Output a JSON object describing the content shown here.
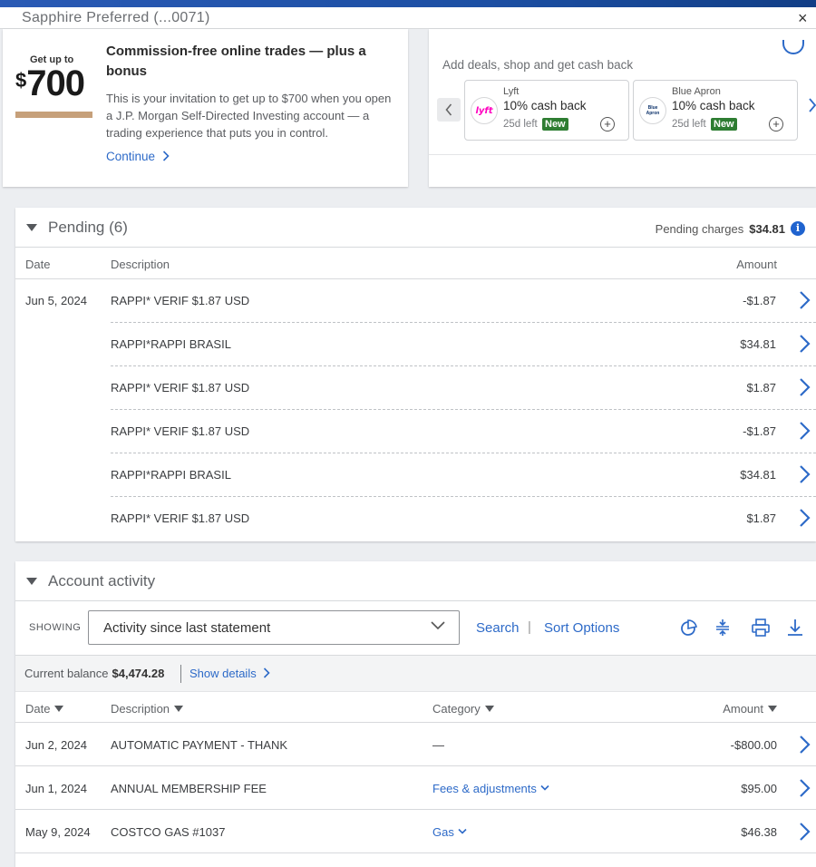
{
  "titlebar": {
    "account": "Sapphire Preferred (...0071)",
    "close": "×"
  },
  "promo": {
    "get_up_to": "Get up to",
    "dollar": "$",
    "amount": "700",
    "headline": "Commission-free online trades — plus a bonus",
    "body": "This is your invitation to get up to $700 when you open a J.P. Morgan Self-Directed Investing account — a trading experience that puts you in control.",
    "continue": "Continue"
  },
  "deals": {
    "title": "Add deals, shop and get cash back",
    "items": [
      {
        "brand": "Lyft",
        "offer": "10% cash back",
        "left": "25d left",
        "badge": "New",
        "logo_text": "lyft",
        "logo_color": "#ff00bf"
      },
      {
        "brand": "Blue Apron",
        "offer": "10% cash back",
        "left": "25d left",
        "badge": "New",
        "logo_text": "Blue Apron",
        "logo_color": "#0f346c"
      }
    ]
  },
  "pending": {
    "title": "Pending (6)",
    "charges_label": "Pending charges",
    "charges_value": "$34.81",
    "columns": {
      "date": "Date",
      "description": "Description",
      "amount": "Amount"
    },
    "rows": [
      {
        "date": "Jun 5, 2024",
        "description": "RAPPI* VERIF $1.87 USD",
        "amount": "-$1.87"
      },
      {
        "date": "",
        "description": "RAPPI*RAPPI BRASIL",
        "amount": "$34.81"
      },
      {
        "date": "",
        "description": "RAPPI* VERIF $1.87 USD",
        "amount": "$1.87"
      },
      {
        "date": "",
        "description": "RAPPI* VERIF $1.87 USD",
        "amount": "-$1.87"
      },
      {
        "date": "",
        "description": "RAPPI*RAPPI BRASIL",
        "amount": "$34.81"
      },
      {
        "date": "",
        "description": "RAPPI* VERIF $1.87 USD",
        "amount": "$1.87"
      }
    ]
  },
  "activity": {
    "title": "Account activity",
    "showing_label": "SHOWING",
    "showing_value": "Activity since last statement",
    "search": "Search",
    "sort_options": "Sort Options",
    "separator": "|",
    "balance_label": "Current balance",
    "balance_value": "$4,474.28",
    "show_details": "Show details",
    "columns": {
      "date": "Date",
      "description": "Description",
      "category": "Category",
      "amount": "Amount"
    },
    "rows": [
      {
        "date": "Jun 2, 2024",
        "description": "AUTOMATIC PAYMENT - THANK",
        "category": "—",
        "amount": "-$800.00"
      },
      {
        "date": "Jun 1, 2024",
        "description": "ANNUAL MEMBERSHIP FEE",
        "category": "Fees & adjustments",
        "amount": "$95.00"
      },
      {
        "date": "May 9, 2024",
        "description": "COSTCO GAS #1037",
        "category": "Gas",
        "amount": "$46.38"
      }
    ]
  },
  "colors": {
    "link": "#2d6ac8",
    "accent_bar": "#c6a07a",
    "new_badge": "#2e7d32",
    "info": "#1f63cf"
  }
}
